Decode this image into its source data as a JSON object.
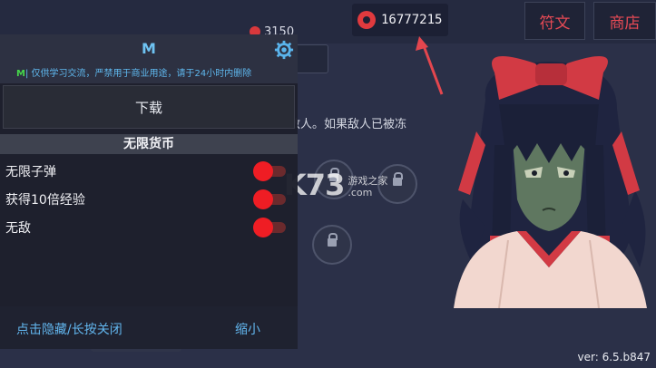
{
  "game": {
    "small_coin_count": "3150",
    "currency_amount": "16777215",
    "buttons": {
      "rune": "符文",
      "shop": "商店"
    },
    "info_text": "敌人。如果敌人已被冻",
    "version": "ver: 6.5.b847"
  },
  "watermark": {
    "brand": "K73",
    "line1": "游戏之家",
    "line2": ".com"
  },
  "menu": {
    "title": "M",
    "disclaimer_tag": "M",
    "disclaimer": "| 仅供学习交流，严禁用于商业用途，请于24小时内删除",
    "download": "下载",
    "section": "无限货币",
    "options": [
      {
        "label": "无限子弹",
        "enabled": true
      },
      {
        "label": "获得10倍经验",
        "enabled": true
      },
      {
        "label": "无敌",
        "enabled": true
      }
    ],
    "footer_left": "点击隐藏/长按关闭",
    "footer_right": "缩小"
  },
  "colors": {
    "accent_red": "#ef1d24",
    "menu_blue": "#62b6ee",
    "rune_text": "#e74a55"
  },
  "icons": [
    "coin-icon",
    "gear-icon",
    "lock-icon",
    "arrow-icon"
  ]
}
